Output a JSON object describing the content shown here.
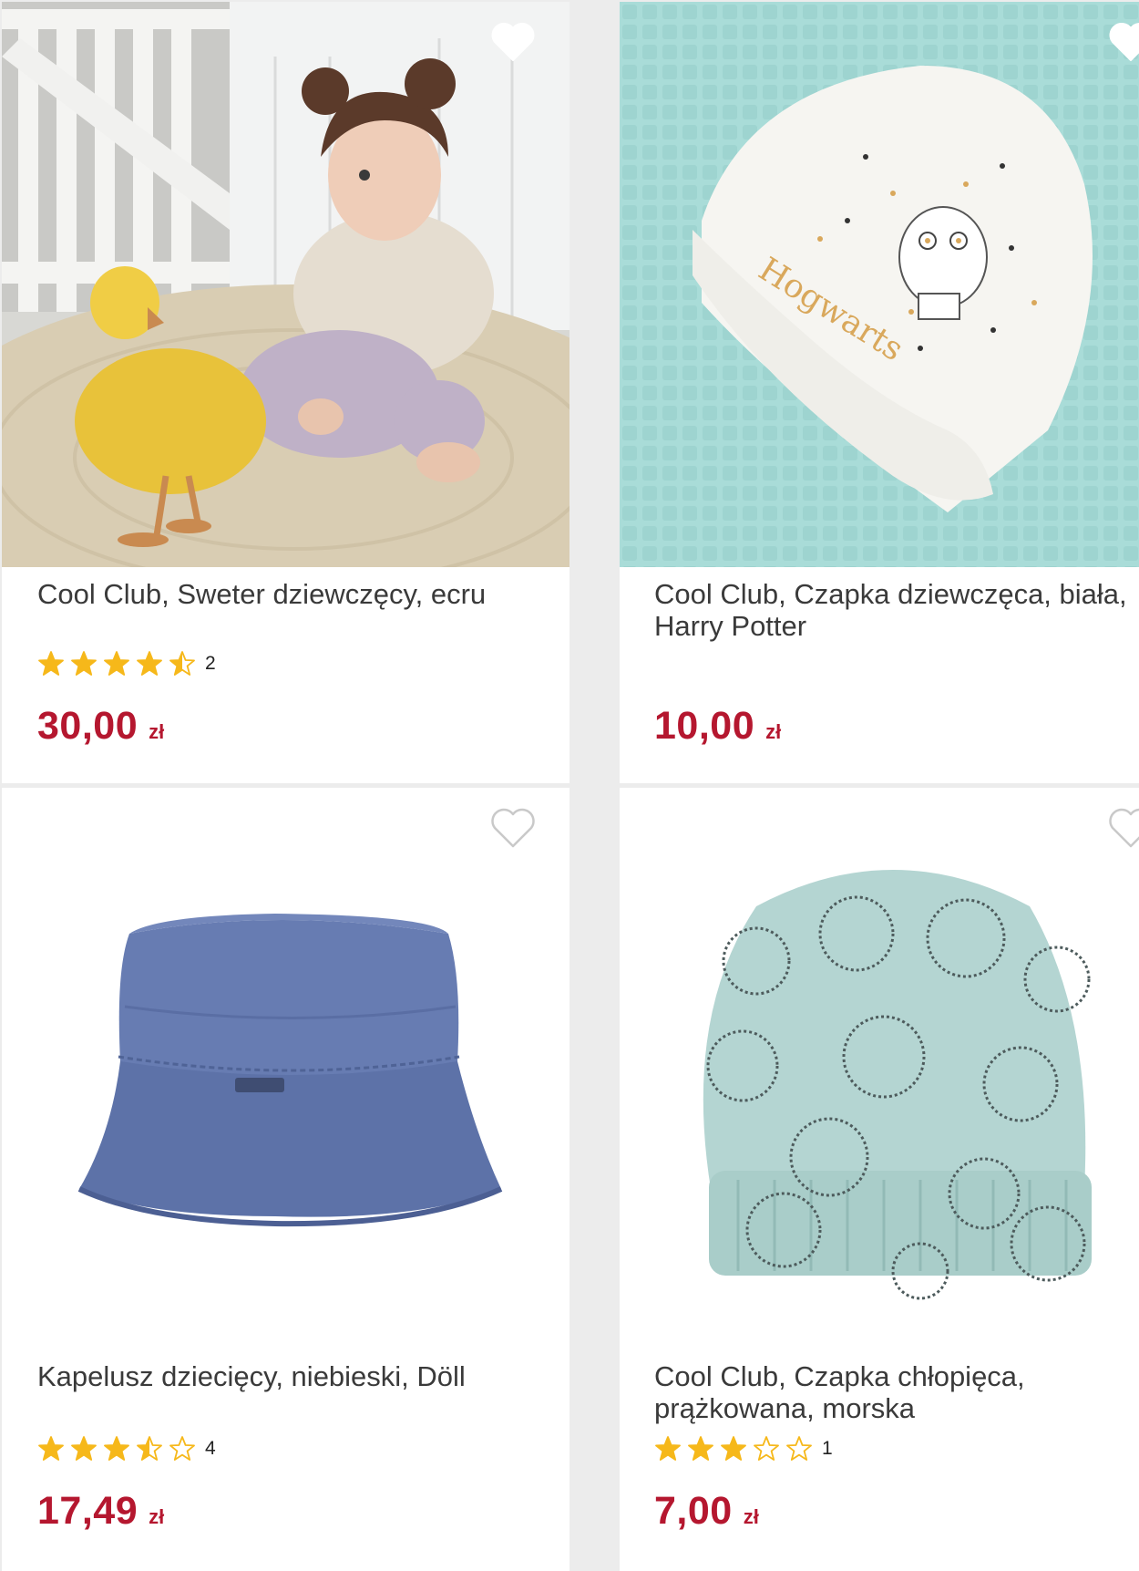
{
  "colors": {
    "price": "#b5172f",
    "star": "#f6b81a",
    "title": "#3a3a3a"
  },
  "products": [
    {
      "title": "Cool Club, Sweter dziewczęcy, ecru",
      "rating": 4.5,
      "rating_count": "2",
      "price": "30,00",
      "currency": "zł",
      "wishlist_icon": "heart-icon"
    },
    {
      "title": "Cool Club, Czapka dziewczęca, biała, Harry Potter",
      "hat_text": "Hogwarts",
      "price": "10,00",
      "currency": "zł",
      "wishlist_icon": "heart-icon"
    },
    {
      "title": "Kapelusz dziecięcy, niebieski, Döll",
      "rating": 3.5,
      "rating_count": "4",
      "price": "17,49",
      "currency": "zł",
      "wishlist_icon": "heart-icon"
    },
    {
      "title": "Cool Club, Czapka chłopięca, prążkowana, morska",
      "rating": 3,
      "rating_count": "1",
      "price": "7,00",
      "currency": "zł",
      "wishlist_icon": "heart-icon"
    }
  ]
}
